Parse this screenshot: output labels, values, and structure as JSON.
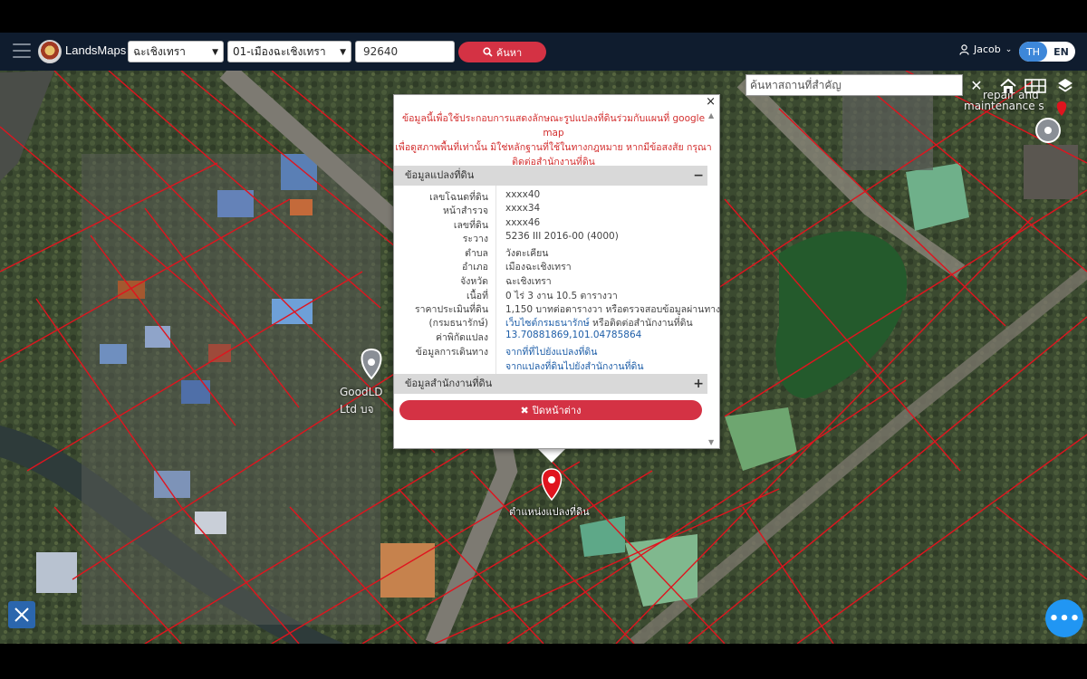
{
  "navbar": {
    "brand": "LandsMaps",
    "province_select": "ฉะเชิงเทรา",
    "district_select": "01-เมืองฉะเชิงเทรา",
    "parcel_input": "92640",
    "search_label": "ค้นหา",
    "user_name": "Jacob",
    "lang_th": "TH",
    "lang_en": "EN"
  },
  "map": {
    "place_search_placeholder": "ค้นหาสถานที่สำคัญ",
    "business_label": "GoodLD",
    "business_label_2": "Ltd บจ",
    "top_right_label_1": "repair and",
    "top_right_label_2": "maintenance s",
    "pin_label": "ตำแหน่งแปลงที่ดิน"
  },
  "popup": {
    "warning": "ข้อมูลนี้เพื่อใช้ประกอบการแสดงลักษณะรูปแปลงที่ดินร่วมกับแผนที่ google map เพื่อดูสภาพพื้นที่เท่านั้น มิใช่หลักฐานที่ใช้ในทางกฎหมาย หากมีข้อสงสัย กรุณาติดต่อสำนักงานที่ดิน",
    "warning_lines": [
      "ข้อมูลนี้เพื่อใช้ประกอบการแสดงลักษณะรูปแปลงที่ดินร่วมกับแผนที่ google map",
      "เพื่อดูสภาพพื้นที่เท่านั้น มิใช่หลักฐานที่ใช้ในทางกฎหมาย หากมีข้อสงสัย กรุณา",
      "ติดต่อสำนักงานที่ดิน"
    ],
    "section_parcel": "ข้อมูลแปลงที่ดิน",
    "section_office": "ข้อมูลสำนักงานที่ดิน",
    "rows": [
      {
        "k": "เลขโฉนดที่ดิน",
        "v": "xxxx40"
      },
      {
        "k": "หน้าสำรวจ",
        "v": "xxxx34"
      },
      {
        "k": "เลขที่ดิน",
        "v": "xxxx46"
      },
      {
        "k": "ระวาง",
        "v": "5236 III 2016-00 (4000)"
      },
      {
        "k": "ตำบล",
        "v": "วังตะเคียน"
      },
      {
        "k": "อำเภอ",
        "v": "เมืองฉะเชิงเทรา"
      },
      {
        "k": "จังหวัด",
        "v": "ฉะเชิงเทรา"
      },
      {
        "k": "เนื้อที่",
        "v": "0 ไร่ 3 งาน 10.5 ตารางวา"
      },
      {
        "k": "ราคาประเมินที่ดิน",
        "v": "1,150 บาทต่อตารางวา หรือตรวจสอบข้อมูลผ่านทาง"
      },
      {
        "k": "(กรมธนารักษ์)",
        "v_link": "เว็บไซต์กรมธนารักษ์",
        "v_rest": " หรือติดต่อสำนักงานที่ดิน"
      },
      {
        "k": "ค่าพิกัดแปลง",
        "v": "13.70881869,101.04785864"
      },
      {
        "k": "ข้อมูลการเดินทาง",
        "v": "จากที่ที่ไปยังแปลงที่ดิน"
      },
      {
        "k": "",
        "v": "จากแปลงที่ดินไปยังสำนักงานที่ดิน"
      }
    ],
    "close_button": "ปิดหน้าต่าง"
  },
  "colors": {
    "navbar_bg": "#0f1c2e",
    "accent_red": "#d43244",
    "accent_blue": "#2196f3",
    "parcel_line": "#e0141e"
  }
}
